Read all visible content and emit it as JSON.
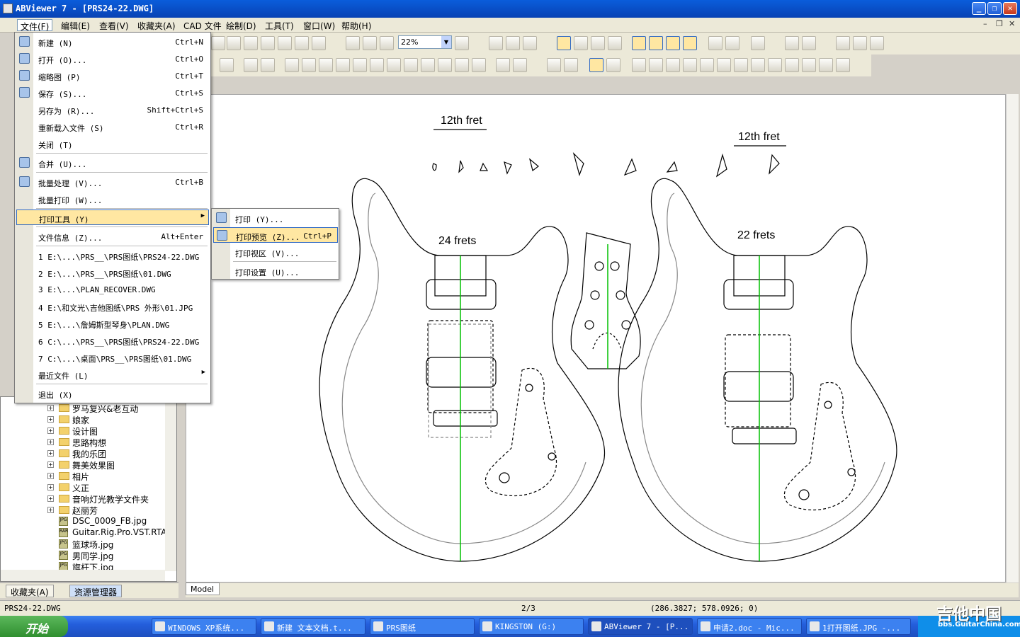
{
  "window": {
    "title": "ABViewer 7 - [PRS24-22.DWG]"
  },
  "menubar": [
    "文件(F)",
    "编辑(E)",
    "查看(V)",
    "收藏夹(A)",
    "CAD 文件",
    "绘制(D)",
    "工具(T)",
    "窗口(W)",
    "帮助(H)"
  ],
  "toolbar": {
    "zoom": "22%"
  },
  "file_menu": {
    "items": [
      {
        "label": "新建 (N)",
        "shortcut": "Ctrl+N"
      },
      {
        "label": "打开 (O)...",
        "shortcut": "Ctrl+O"
      },
      {
        "label": "缩略图 (P)",
        "shortcut": "Ctrl+T"
      },
      {
        "label": "保存 (S)...",
        "shortcut": "Ctrl+S"
      },
      {
        "label": "另存为 (R)...",
        "shortcut": "Shift+Ctrl+S"
      },
      {
        "label": "重新载入文件 (S)",
        "shortcut": "Ctrl+R"
      },
      {
        "label": "关闭 (T)",
        "shortcut": ""
      },
      {
        "label": "合并 (U)...",
        "shortcut": ""
      },
      {
        "label": "批量处理 (V)...",
        "shortcut": "Ctrl+B"
      },
      {
        "label": "批量打印 (W)...",
        "shortcut": ""
      },
      {
        "label": "打印工具 (Y)",
        "shortcut": ""
      },
      {
        "label": "文件信息 (Z)...",
        "shortcut": "Alt+Enter"
      },
      {
        "label": "1 E:\\...\\PRS__\\PRS图纸\\PRS24-22.DWG",
        "shortcut": ""
      },
      {
        "label": "2 E:\\...\\PRS__\\PRS图纸\\01.DWG",
        "shortcut": ""
      },
      {
        "label": "3 E:\\...\\PLAN_RECOVER.DWG",
        "shortcut": ""
      },
      {
        "label": "4 E:\\和文光\\吉他图纸\\PRS 外形\\01.JPG",
        "shortcut": ""
      },
      {
        "label": "5 E:\\...\\詹姆斯型琴身\\PLAN.DWG",
        "shortcut": ""
      },
      {
        "label": "6 C:\\...\\PRS__\\PRS图纸\\PRS24-22.DWG",
        "shortcut": ""
      },
      {
        "label": "7 C:\\...\\桌面\\PRS__\\PRS图纸\\01.DWG",
        "shortcut": ""
      },
      {
        "label": "最近文件 (L)",
        "shortcut": ""
      },
      {
        "label": "退出 (X)",
        "shortcut": ""
      }
    ]
  },
  "print_submenu": [
    {
      "label": "打印 (Y)...",
      "shortcut": ""
    },
    {
      "label": "打印预览 (Z)...",
      "shortcut": "Ctrl+P"
    },
    {
      "label": "打印视区 (V)...",
      "shortcut": ""
    },
    {
      "label": "打印设置 (U)...",
      "shortcut": ""
    }
  ],
  "tree": {
    "folders": [
      "罗马复兴&老互动",
      "娘家",
      "设计图",
      "思路构想",
      "我的乐团",
      "舞美效果图",
      "相片",
      "义正",
      "音响灯光教学文件夹",
      "赵丽芳"
    ],
    "files": [
      "DSC_0009_FB.jpg",
      "Guitar.Rig.Pro.VST.RTAS.v",
      "篮球场.jpg",
      "男同学.jpg",
      "旗杆下.jpg"
    ]
  },
  "panel_tabs": [
    "收藏夹(A)",
    "资源管理器"
  ],
  "drawing": {
    "labels": [
      "12th fret",
      "12th fret",
      "24 frets",
      "22 frets"
    ]
  },
  "model_tab": "Model",
  "status": {
    "file": "PRS24-22.DWG",
    "page": "2/3",
    "coords": "(286.3827; 578.0926; 0)"
  },
  "taskbar": {
    "start": "开始",
    "tasks": [
      "WINDOWS XP系统...",
      "新建 文本文档.t...",
      "PRS图纸",
      "KINGSTON (G:)",
      "ABViewer 7 - [P...",
      "申请2.doc - Mic...",
      "1打开图纸.JPG -..."
    ]
  },
  "watermark": {
    "text": "吉他中国",
    "sub": "bbs.GuitarChina.com"
  },
  "colors": {
    "center_line": "#00c000",
    "highlight": "#ffe7a2",
    "titlebar": "#0a5ddb"
  }
}
